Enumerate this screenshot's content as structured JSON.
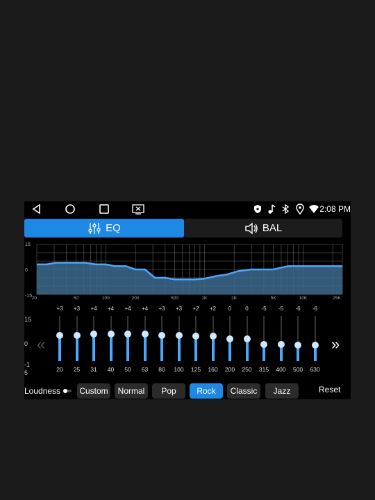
{
  "status": {
    "time": "2:08 PM"
  },
  "tabs": [
    {
      "label": "EQ",
      "icon": "sliders-icon",
      "active": true
    },
    {
      "label": "BAL",
      "icon": "speaker-icon",
      "active": false
    }
  ],
  "graph": {
    "y_ticks": [
      "15",
      "0",
      "-15"
    ],
    "x_ticks": [
      "20",
      "50",
      "100",
      "200",
      "500",
      "1K",
      "2K",
      "5K",
      "10K",
      "25K"
    ]
  },
  "eq": {
    "scale_top": "15",
    "scale_mid": "0",
    "scale_bottom_1": "-1",
    "scale_bottom_2": "5",
    "bands": [
      {
        "freq": "20",
        "value": "+3",
        "gain": 3
      },
      {
        "freq": "25",
        "value": "+3",
        "gain": 3
      },
      {
        "freq": "31",
        "value": "+4",
        "gain": 4
      },
      {
        "freq": "40",
        "value": "+4",
        "gain": 4
      },
      {
        "freq": "50",
        "value": "+4",
        "gain": 4
      },
      {
        "freq": "63",
        "value": "+4",
        "gain": 4
      },
      {
        "freq": "80",
        "value": "+3",
        "gain": 3
      },
      {
        "freq": "100",
        "value": "+3",
        "gain": 3
      },
      {
        "freq": "125",
        "value": "+2",
        "gain": 2
      },
      {
        "freq": "160",
        "value": "+2",
        "gain": 2
      },
      {
        "freq": "200",
        "value": "0",
        "gain": 0
      },
      {
        "freq": "250",
        "value": "0",
        "gain": 0
      },
      {
        "freq": "315",
        "value": "-5",
        "gain": -5
      },
      {
        "freq": "400",
        "value": "-5",
        "gain": -5
      },
      {
        "freq": "500",
        "value": "-6",
        "gain": -6
      },
      {
        "freq": "630",
        "value": "-6",
        "gain": -6
      }
    ]
  },
  "loudness": {
    "label": "Loudness",
    "enabled": false
  },
  "presets": [
    {
      "label": "Custom",
      "active": false
    },
    {
      "label": "Normal",
      "active": false
    },
    {
      "label": "Pop",
      "active": false
    },
    {
      "label": "Rock",
      "active": true
    },
    {
      "label": "Classic",
      "active": false
    },
    {
      "label": "Jazz",
      "active": false
    }
  ],
  "reset_label": "Reset",
  "colors": {
    "accent": "#1e88e5",
    "curve": "#4aa8ff",
    "fill": "#3d6a8f"
  }
}
